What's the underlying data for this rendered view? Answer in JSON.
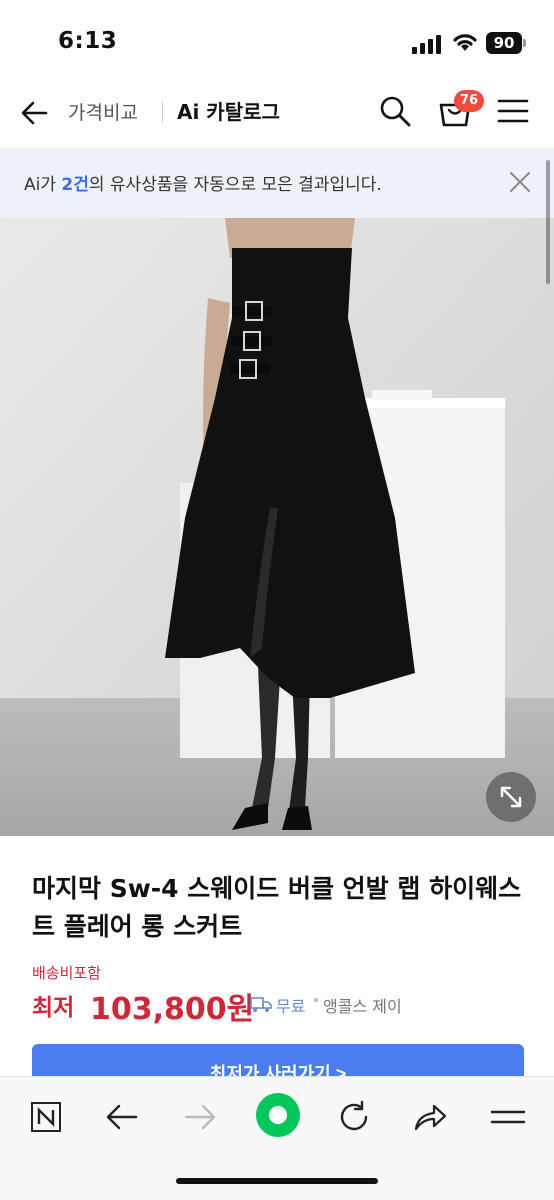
{
  "status": {
    "time": "6:13",
    "battery": "90"
  },
  "header": {
    "sub_label": "가격비교",
    "title": "Ai 카탈로그",
    "cart_count": "76"
  },
  "banner": {
    "prefix": "Ai가 ",
    "count": "2건",
    "suffix": "의 유사상품을 자동으로 모은 결과입니다."
  },
  "product": {
    "title": "마지막 Sw-4 스웨이드 버클 언발 랩 하이웨스트 플레어 롱 스커트",
    "shipping_note": "배송비포함",
    "price_label": "최저",
    "price_value": "103,800원",
    "delivery": "무료",
    "separator": "•",
    "seller": "앵콜스 제이"
  },
  "buy_button": {
    "label": "최저가 사러가기 >"
  },
  "colors": {
    "accent_blue": "#4b7cf0",
    "price_red": "#d0273a",
    "badge_red": "#f04b3f",
    "banner_bg": "#eef2f8",
    "naver_green": "#03c75a"
  },
  "icons": {
    "back": "arrow-left-icon",
    "search": "search-icon",
    "cart": "cart-icon",
    "menu": "hamburger-icon",
    "close": "close-icon",
    "expand": "expand-icon",
    "delivery": "truck-icon",
    "nav": [
      "naver-n-icon",
      "back-arrow-icon",
      "forward-arrow-icon",
      "green-dot-icon",
      "refresh-icon",
      "share-icon",
      "menu-icon"
    ]
  }
}
